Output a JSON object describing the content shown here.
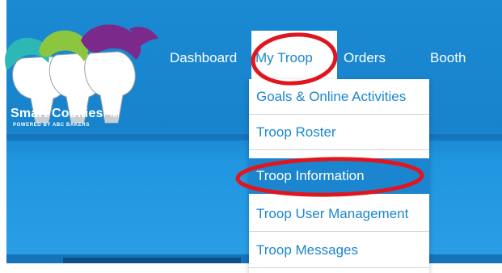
{
  "app": {
    "logo_text": "Smart Cookies",
    "logo_trademark": "TM",
    "logo_tagline": "POWERED BY ABC BAKERS"
  },
  "nav": {
    "items": [
      {
        "label": "Dashboard"
      },
      {
        "label": "My Troop"
      },
      {
        "label": "Orders"
      },
      {
        "label": "Booth"
      }
    ]
  },
  "dropdown": {
    "items": [
      {
        "label": "Goals & Online Activities"
      },
      {
        "label": "Troop Roster"
      },
      {
        "label": "Troop Information",
        "active": true
      },
      {
        "label": "Troop User Management"
      },
      {
        "label": "Troop Messages"
      }
    ]
  },
  "colors": {
    "header_blue": "#1b8ad2",
    "accent_blue": "#1b86cf",
    "annotation_red": "#e0161f",
    "logo_teal": "#2cb9b6",
    "logo_green": "#8cc63f",
    "logo_purple": "#7b2a8c"
  }
}
